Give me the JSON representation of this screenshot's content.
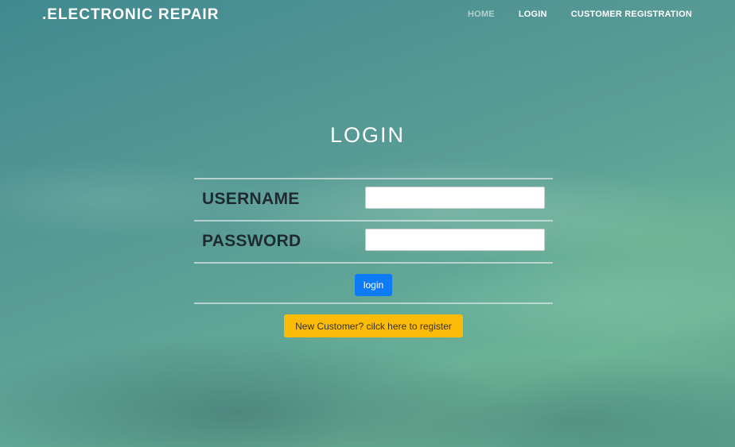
{
  "navbar": {
    "brand": ".ELECTRONIC REPAIR",
    "links": [
      {
        "label": "HOME",
        "state": "muted"
      },
      {
        "label": "LOGIN",
        "state": "normal"
      },
      {
        "label": "CUSTOMER REGISTRATION",
        "state": "normal"
      }
    ]
  },
  "page": {
    "title": "LOGIN"
  },
  "form": {
    "username_label": "USERNAME",
    "username_value": "",
    "password_label": "PASSWORD",
    "password_value": "",
    "login_button": "login",
    "register_button": "New Customer? cilck here to register"
  },
  "colors": {
    "login_button": "#0d7bf6",
    "register_button": "#fbbc09",
    "label_text": "#1f2a30"
  }
}
